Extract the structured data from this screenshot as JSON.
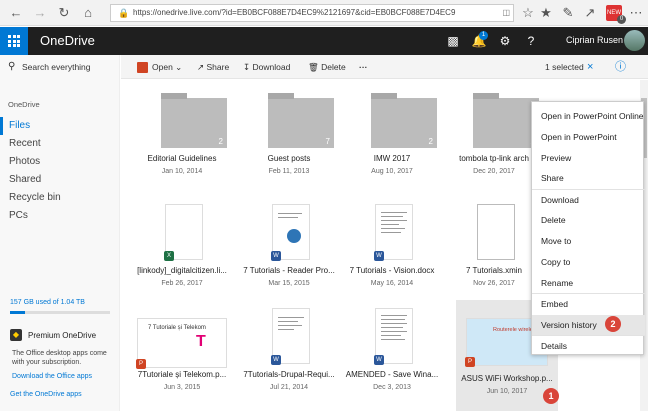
{
  "browser": {
    "url": "https://onedrive.live.com/?id=EB0BCF088E7D4EC9%2121697&cid=EB0BCF088E7D4EC9",
    "ext_badge": "0",
    "ext_label": "NEW"
  },
  "app": {
    "brand": "OneDrive",
    "user_name": "Ciprian Rusen",
    "notifications": "1"
  },
  "sidebar": {
    "search_placeholder": "Search everything",
    "header": "OneDrive",
    "items": [
      {
        "label": "Files",
        "active": true
      },
      {
        "label": "Recent"
      },
      {
        "label": "Photos"
      },
      {
        "label": "Shared"
      },
      {
        "label": "Recycle bin"
      },
      {
        "label": "PCs"
      }
    ],
    "storage": "157 GB used of 1.04 TB",
    "storage_fraction": 0.15,
    "premium_title": "Premium OneDrive",
    "premium_desc": "The Office desktop apps come with your subscription.",
    "premium_link": "Download the Office apps",
    "get_apps": "Get the OneDrive apps"
  },
  "commands": {
    "open": "Open",
    "share": "Share",
    "download": "Download",
    "delete": "Delete",
    "more": "···",
    "selected": "1 selected"
  },
  "files": [
    {
      "name": "Editorial Guidelines",
      "date": "Jan 10, 2014",
      "kind": "folder",
      "count": "2"
    },
    {
      "name": "Guest posts",
      "date": "Feb 11, 2013",
      "kind": "folder",
      "count": "7"
    },
    {
      "name": "IMW 2017",
      "date": "Aug 10, 2017",
      "kind": "folder",
      "count": "2"
    },
    {
      "name": "tombola tp-link arch",
      "date": "Dec 20, 2017",
      "kind": "folder",
      "count": "2"
    },
    {
      "name": "[linkody]_digitalcitizen.li...",
      "date": "Feb 26, 2017",
      "kind": "excel"
    },
    {
      "name": "7 Tutorials - Reader Pro...",
      "date": "Mar 15, 2015",
      "kind": "word"
    },
    {
      "name": "7 Tutorials - Vision.docx",
      "date": "May 16, 2014",
      "kind": "word"
    },
    {
      "name": "7 Tutorials.xmin",
      "date": "Nov 26, 2017",
      "kind": "blank"
    },
    {
      "name": "7Tutoriale și Telekom.p...",
      "date": "Jun 3, 2015",
      "kind": "ppt"
    },
    {
      "name": "7Tutorials-Drupal-Requi...",
      "date": "Jul 21, 2014",
      "kind": "word"
    },
    {
      "name": "AMENDED - Save Wina...",
      "date": "Dec 3, 2013",
      "kind": "word"
    },
    {
      "name": "ASUS WiFi Workshop.p...",
      "date": "Jun 10, 2017",
      "kind": "ppt"
    }
  ],
  "thumb_text": {
    "telekom": "7 Tutoriale și Telekom",
    "asus": "Routerele wireless ASUS"
  },
  "context_menu": [
    "Open in PowerPoint Online",
    "Open in PowerPoint",
    "Preview",
    "Share",
    "Download",
    "Delete",
    "Move to",
    "Copy to",
    "Rename",
    "Embed",
    "Version history",
    "Details"
  ],
  "callouts": [
    "1",
    "2"
  ],
  "colors": {
    "accent": "#0078d4",
    "topbar": "#1f1f1f",
    "callout": "#d9453a"
  }
}
